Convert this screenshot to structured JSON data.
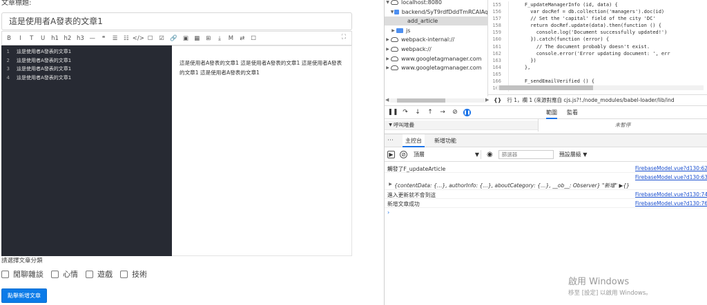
{
  "editor": {
    "title_label": "文章標題:",
    "title_value": "這是使用者A發表的文章1",
    "toolbar_buttons": [
      "B",
      "I",
      "T",
      "U",
      "h1",
      "h2",
      "h3",
      "—",
      "❝",
      "☰",
      "☷",
      "</>",
      "☐",
      "☑",
      "🔗",
      "▣",
      "▦",
      "⊞",
      "⤓",
      "M",
      "⇄",
      "☐"
    ],
    "fullscreen_icon": "⛶",
    "lines": [
      {
        "num": "1",
        "text": "這是使用者A發表的文章1"
      },
      {
        "num": "2",
        "text": "這是使用者A發表的文章1"
      },
      {
        "num": "3",
        "text": "這是使用者A發表的文章1"
      },
      {
        "num": "4",
        "text": "這是使用者A發表的文章1"
      }
    ],
    "preview_text": "這是使用者A發表的文章1 這是使用者A發表的文章1 這是使用者A發表的文章1 這是使用者A發表的文章1"
  },
  "category": {
    "label": "請選擇文章分類",
    "options": [
      "閒聊雜談",
      "心情",
      "遊戲",
      "技術"
    ]
  },
  "submit_label": "點擊新增文章",
  "devtools": {
    "nav": [
      {
        "indent": 0,
        "tri": "▼",
        "icon": "cloud",
        "label": "localhost:8080",
        "selected": false
      },
      {
        "indent": 1,
        "tri": "▼",
        "icon": "folder",
        "label": "backend/SyT9rdfDddTmRCAIAq",
        "selected": false
      },
      {
        "indent": 3,
        "tri": "",
        "icon": "file",
        "label": "add_article",
        "selected": true
      },
      {
        "indent": 1,
        "tri": "▶",
        "icon": "folder",
        "label": "js",
        "selected": false
      },
      {
        "indent": 0,
        "tri": "▶",
        "icon": "cloud",
        "label": "webpack-internal://",
        "selected": false
      },
      {
        "indent": 0,
        "tri": "▶",
        "icon": "cloud",
        "label": "webpack://",
        "selected": false
      },
      {
        "indent": 0,
        "tri": "▶",
        "icon": "cloud",
        "label": "www.googletagmanager.com",
        "selected": false
      },
      {
        "indent": 0,
        "tri": "▶",
        "icon": "cloud",
        "label": "www.googletagmanager.com",
        "selected": false
      }
    ],
    "code": [
      {
        "ln": "155",
        "text": "    F_updateManagerInfo (id, data) {"
      },
      {
        "ln": "156",
        "text": "      var docRef = db.collection('managers').doc(id)"
      },
      {
        "ln": "157",
        "text": "      // Set the 'capital' field of the city 'DC'"
      },
      {
        "ln": "158",
        "text": "      return docRef.update(data).then(function () {"
      },
      {
        "ln": "159",
        "text": "        console.log('Document successfully updated!')"
      },
      {
        "ln": "160",
        "text": "      }).catch(function (error) {"
      },
      {
        "ln": "161",
        "text": "        // The document probably doesn't exist."
      },
      {
        "ln": "162",
        "text": "        console.error('Error updating document: ', err"
      },
      {
        "ln": "163",
        "text": "      })"
      },
      {
        "ln": "164",
        "text": "    },"
      },
      {
        "ln": "165",
        "text": ""
      },
      {
        "ln": "166",
        "text": "    F_sendEmailVerified () {"
      },
      {
        "ln": "167",
        "text": ""
      }
    ],
    "status_brace": "{}",
    "status_text": "行 1，欄 1 (來源對應自 cjs.js?!./node_modules/babel-loader/lib/ind",
    "scope_tabs": [
      "範圍",
      "監看"
    ],
    "watch_label": "呼叫堆疊",
    "not_paused": "未暫停",
    "drawer_menu": "⋯",
    "drawer_tabs": [
      "主控台",
      "新增功能"
    ],
    "context_value": "頂層",
    "filter_placeholder": "篩選器",
    "levels_label": "預設層級 ▼",
    "logs": [
      {
        "msg": "觸發了F_updateArticle",
        "src": "FirebaseModel.vue?d130:62",
        "obj": ""
      },
      {
        "msg": "",
        "src": "FirebaseModel.vue?d130:63",
        "obj": "{contentData: {…}, authorInfo: {…}, aboutCategory: {…}, __ob__: Observer} \"新增\" ▶{}"
      },
      {
        "msg": "進入更新就不會到這",
        "src": "FirebaseModel.vue?d130:74",
        "obj": ""
      },
      {
        "msg": "新增文章成功",
        "src": "FirebaseModel.vue?d130:76",
        "obj": ""
      }
    ],
    "prompt": "›"
  },
  "windows": {
    "title": "啟用 Windows",
    "subtitle": "移至 [設定] 以啟用 Windows。"
  }
}
